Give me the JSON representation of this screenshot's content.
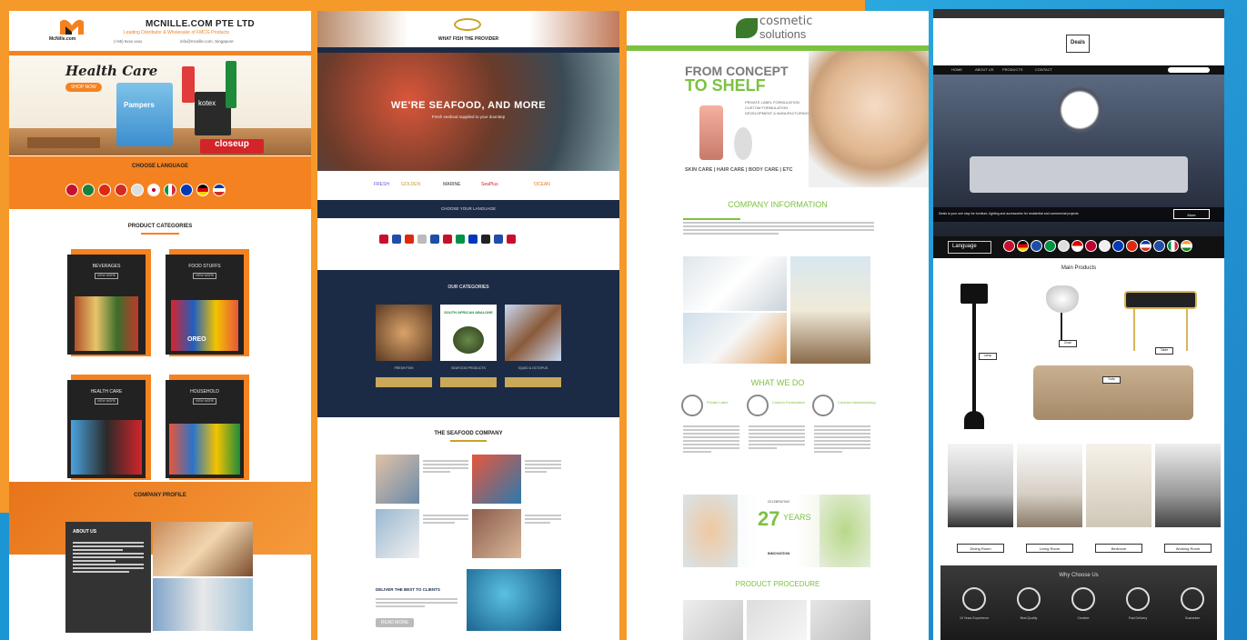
{
  "p1": {
    "company": "MCNILLE.COM PTE LTD",
    "tagline": "Leading Distributor & Wholesaler of FMCG Products",
    "logo_text": "McNille.com",
    "contact_phone": "(+65) 6xxx xxxx",
    "contact_email": "info@mcnille.com, Singapore",
    "hero_title": "Health Care",
    "hero_button": "SHOP NOW",
    "brand_tags": [
      "Pampers",
      "kotex",
      "closeup"
    ],
    "languages_title": "CHOOSE LANGUAGE",
    "categories_title": "PRODUCT CATEGORIES",
    "categories": [
      {
        "label": "BEVERAGES",
        "btn": "VIEW MORE"
      },
      {
        "label": "FOOD STUFFS",
        "btn": "VIEW MORE"
      },
      {
        "label": "HEALTH CARE",
        "btn": "VIEW MORE"
      },
      {
        "label": "HOUSEHOLD",
        "btn": "VIEW MORE"
      }
    ],
    "snack_labels": [
      "OREO",
      "closeup"
    ],
    "profile_title": "COMPANY PROFILE",
    "about_title": "ABOUT US"
  },
  "p2": {
    "header_title": "WHAT FISH THE PROVIDER",
    "hero_title": "WE'RE SEAFOOD, AND MORE",
    "hero_sub": "Fresh seafood supplied to your doorstep",
    "partner_logos": [
      "FRESH",
      "GOLDEN",
      "MARINE",
      "SeaPlus",
      "OCEAN"
    ],
    "language_bar": "CHOOSE YOUR LANGUAGE",
    "products_title": "OUR CATEGORIES",
    "products": [
      {
        "label": "FRESH FISH",
        "btn": ""
      },
      {
        "label": "SEAFOOD PRODUCTS",
        "btn": ""
      },
      {
        "label": "SQUID & OCTOPUS",
        "btn": ""
      }
    ],
    "abalone_label": "SOUTH AFRICAN ABALONE",
    "company_title": "THE SEAFOOD COMPANY",
    "dive_title": "DELIVER THE BEST TO CLIENTS",
    "dive_button": "READ MORE"
  },
  "p3": {
    "logo_line1": "cosmetic",
    "logo_line2": "solutions",
    "hero_line1": "FROM CONCEPT",
    "hero_line2": "TO SHELF",
    "hero_bullets": [
      "PRIVATE LABEL FORMULATION",
      "CUSTOM FORMULATION",
      "DEVELOPMENT & MANUFACTURING"
    ],
    "hero_categories": "SKIN CARE | HAIR CARE | BODY CARE | ETC",
    "info_title": "COMPANY INFORMATION",
    "what_title": "WHAT WE DO",
    "services": [
      "Private Label",
      "Custom Formulation",
      "Contract Manufacturing"
    ],
    "years_top": "CELEBRATING",
    "years_num": "27",
    "years_word": "YEARS",
    "years_bottom": "INNOVATION",
    "procedure_title": "PRODUCT PROCEDURE",
    "green": "#7cc242"
  },
  "p4": {
    "logo": "Deals",
    "nav": [
      "HOME",
      "ABOUT US",
      "PRODUCTS",
      "CONTACT"
    ],
    "hero_caption": "Deals is your one stop for furniture, lighting and accessories for residential and commercial projects",
    "hero_button": "More",
    "lang_label": "Language",
    "products_title": "Main Products",
    "product_tags": [
      "Lamp",
      "Chair",
      "Table",
      "Sofa"
    ],
    "rooms": [
      "Dining Room",
      "Living Room",
      "Bedroom",
      "Working Room"
    ],
    "why_title": "Why Choose Us",
    "why_items": [
      "10 Years Experience",
      "Best Quality",
      "Creative",
      "Fast Delivery",
      "Guarantee"
    ]
  }
}
